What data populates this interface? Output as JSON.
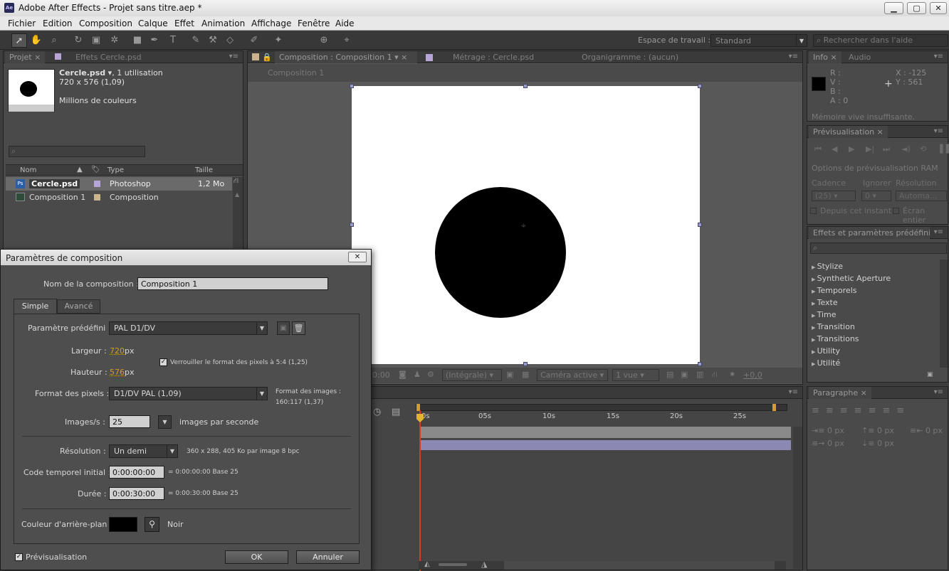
{
  "window": {
    "title": "Adobe After Effects - Projet sans titre.aep *",
    "app_icon": "Ae"
  },
  "menu": [
    "Fichier",
    "Edition",
    "Composition",
    "Calque",
    "Effet",
    "Animation",
    "Affichage",
    "Fenêtre",
    "Aide"
  ],
  "workspace": {
    "label": "Espace de travail :",
    "value": "Standard",
    "search_placeholder": "Rechercher dans l'aide"
  },
  "project": {
    "tab": "Projet",
    "tab2": "Effets Cercle.psd",
    "item_name": "Cercle.psd",
    "item_usage": ", 1 utilisation",
    "item_dims": "720 x 576 (1,09)",
    "item_colors": "Millions de couleurs",
    "cols": {
      "name": "Nom",
      "type": "Type",
      "size": "Taille"
    },
    "rows": [
      {
        "name": "Cercle.psd",
        "type": "Photoshop",
        "size": "1,2 Mo"
      },
      {
        "name": "Composition 1",
        "type": "Composition",
        "size": ""
      }
    ]
  },
  "comp": {
    "tab": "Composition : Composition 1",
    "tab2": "Métrage : Cercle.psd",
    "tab3": "Organigramme : (aucun)",
    "breadcrumb": "Composition 1",
    "bottom": {
      "time": "0:00",
      "res": "(Intégrale)",
      "camera": "Caméra active",
      "views": "1 vue",
      "exposure": "+0,0"
    }
  },
  "info": {
    "tab": "Info",
    "tab2": "Audio",
    "r": "R :",
    "v": "V :",
    "b": "B :",
    "a": "A : 0",
    "x": "X : -125",
    "y": "Y : 561",
    "warning": "Mémoire vive insuffisante."
  },
  "preview": {
    "tab": "Prévisualisation",
    "ram_options": "Options de prévisualisation RAM",
    "cadence": "Cadence",
    "ignore": "Ignorer",
    "resolution": "Résolution",
    "cadence_val": "(25)",
    "ignore_val": "0",
    "res_val": "Automa...",
    "from_now": "Depuis cet instant",
    "fullscreen": "Écran entier"
  },
  "effects": {
    "tab": "Effets et paramètres prédéfinis",
    "items": [
      "Stylize",
      "Synthetic Aperture",
      "Temporels",
      "Texte",
      "Time",
      "Transition",
      "Transitions",
      "Utility",
      "Utilité"
    ]
  },
  "paragraph": {
    "tab": "Paragraphe",
    "vals": [
      "0 px",
      "0 px",
      "0 px",
      "0 px",
      "0 px"
    ]
  },
  "timeline": {
    "ticks": [
      "0s",
      "05s",
      "10s",
      "15s",
      "20s",
      "25s"
    ]
  },
  "dialog": {
    "title": "Paramètres de composition",
    "name_label": "Nom de la composition :",
    "name_value": "Composition 1",
    "tab_simple": "Simple",
    "tab_advanced": "Avancé",
    "preset_label": "Paramètre prédéfini :",
    "preset_value": "PAL D1/DV",
    "width_label": "Largeur :",
    "width_value": "720",
    "unit_px": "px",
    "height_label": "Hauteur :",
    "height_value": "576",
    "lock_label": "Verrouiller le format des pixels à 5:4 (1,25)",
    "pixel_label": "Format des pixels :",
    "pixel_value": "D1/DV PAL (1,09)",
    "image_format_label": "Format des images :",
    "image_format_value": "160:117 (1,37)",
    "fps_label": "Images/s :",
    "fps_value": "25",
    "fps_unit": "images par seconde",
    "res_label": "Résolution :",
    "res_value": "Un demi",
    "res_info": "360 x 288, 405 Ko par image 8 bpc",
    "tc_label": "Code temporel initial :",
    "tc_value": "0:00:00:00",
    "tc_info": "= 0:00:00:00  Base 25",
    "dur_label": "Durée :",
    "dur_value": "0:00:30:00",
    "dur_info": "= 0:00:30:00  Base 25",
    "bg_label": "Couleur d'arrière-plan :",
    "bg_name": "Noir",
    "preview_label": "Prévisualisation",
    "ok": "OK",
    "cancel": "Annuler"
  }
}
